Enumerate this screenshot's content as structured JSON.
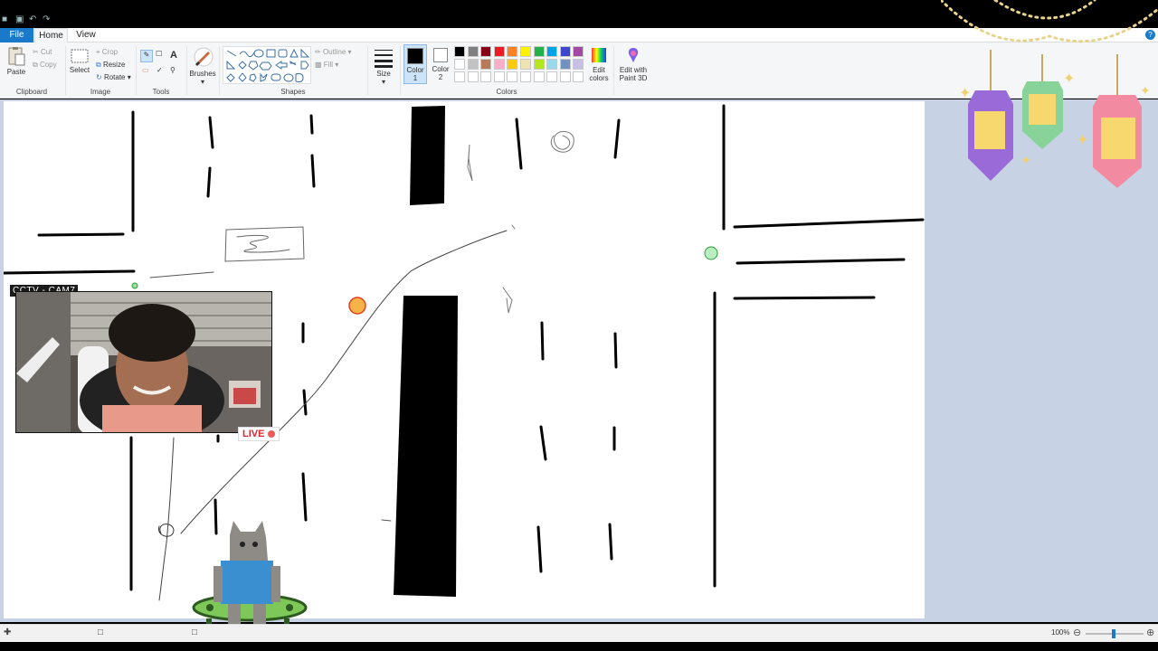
{
  "menu": {
    "file": "File",
    "home": "Home",
    "view": "View"
  },
  "clipboard": {
    "paste": "Paste",
    "cut": "Cut",
    "copy": "Copy",
    "label": "Clipboard"
  },
  "image": {
    "select": "Select",
    "crop": "Crop",
    "resize": "Resize",
    "rotate": "Rotate",
    "label": "Image"
  },
  "tools": {
    "label": "Tools"
  },
  "brushes": {
    "label": "Brushes"
  },
  "shapes": {
    "outline": "Outline",
    "fill": "Fill",
    "label": "Shapes"
  },
  "size": {
    "label": "Size"
  },
  "colors": {
    "color1_line1": "Color",
    "color1_line2": "1",
    "color2_line1": "Color",
    "color2_line2": "2",
    "edit_colors_line1": "Edit",
    "edit_colors_line2": "colors",
    "paint3d_line1": "Edit with",
    "paint3d_line2": "Paint 3D",
    "label": "Colors",
    "palette_row1": [
      "#000000",
      "#7f7f7f",
      "#880015",
      "#ed1c24",
      "#ff7f27",
      "#fff200",
      "#22b14c",
      "#00a2e8",
      "#3f48cc",
      "#a349a4"
    ],
    "palette_row2": [
      "#ffffff",
      "#c3c3c3",
      "#b97a57",
      "#ffaec9",
      "#ffc90e",
      "#efe4b0",
      "#b5e61d",
      "#99d9ea",
      "#7092be",
      "#c8bfe7"
    ],
    "color1": "#000000",
    "color2": "#ffffff"
  },
  "overlay": {
    "camera_label": "CCTV - CAM7",
    "live_label": "LIVE"
  },
  "status": {
    "zoom": "100%"
  }
}
